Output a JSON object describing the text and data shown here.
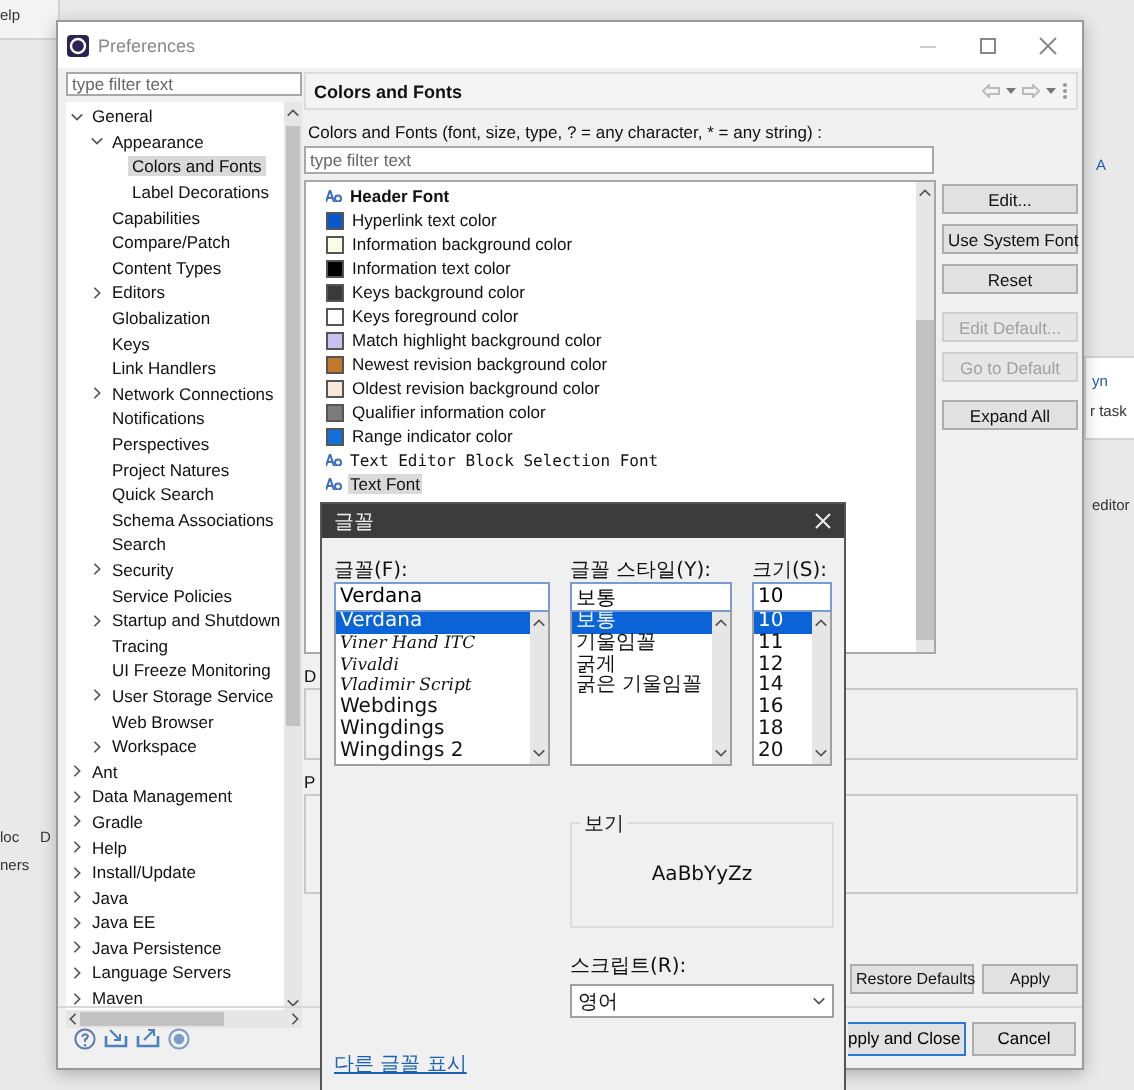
{
  "backdrop": {
    "menu_fragment": "elp",
    "tab_fragments": [
      "loc",
      "D"
    ],
    "column_fragment": "ners",
    "right_fragments": [
      {
        "kind": "link",
        "text": "A"
      },
      {
        "kind": "link",
        "text": "yn"
      },
      {
        "kind": "text",
        "text": "r task"
      },
      {
        "kind": "text",
        "text": "editor"
      }
    ]
  },
  "window": {
    "title": "Preferences"
  },
  "sidebar": {
    "filter_placeholder": "type filter text",
    "tree": [
      {
        "label": "General",
        "expanded": true,
        "selected": false,
        "children": [
          {
            "label": "Appearance",
            "expanded": true,
            "selected": false,
            "children": [
              {
                "label": "Colors and Fonts",
                "selected": true
              },
              {
                "label": "Label Decorations",
                "selected": false
              }
            ]
          },
          {
            "label": "Capabilities",
            "selected": false
          },
          {
            "label": "Compare/Patch",
            "selected": false
          },
          {
            "label": "Content Types",
            "selected": false
          },
          {
            "label": "Editors",
            "expanded": false,
            "selected": false
          },
          {
            "label": "Globalization",
            "selected": false
          },
          {
            "label": "Keys",
            "selected": false
          },
          {
            "label": "Link Handlers",
            "selected": false
          },
          {
            "label": "Network Connections",
            "expanded": false,
            "selected": false
          },
          {
            "label": "Notifications",
            "selected": false
          },
          {
            "label": "Perspectives",
            "selected": false
          },
          {
            "label": "Project Natures",
            "selected": false
          },
          {
            "label": "Quick Search",
            "selected": false
          },
          {
            "label": "Schema Associations",
            "selected": false
          },
          {
            "label": "Search",
            "selected": false
          },
          {
            "label": "Security",
            "expanded": false,
            "selected": false
          },
          {
            "label": "Service Policies",
            "selected": false
          },
          {
            "label": "Startup and Shutdown",
            "expanded": false,
            "selected": false
          },
          {
            "label": "Tracing",
            "selected": false
          },
          {
            "label": "UI Freeze Monitoring",
            "selected": false
          },
          {
            "label": "User Storage Service",
            "expanded": false,
            "selected": false
          },
          {
            "label": "Web Browser",
            "selected": false
          },
          {
            "label": "Workspace",
            "expanded": false,
            "selected": false
          }
        ]
      },
      {
        "label": "Ant",
        "expanded": false,
        "selected": false
      },
      {
        "label": "Data Management",
        "expanded": false,
        "selected": false
      },
      {
        "label": "Gradle",
        "expanded": false,
        "selected": false
      },
      {
        "label": "Help",
        "expanded": false,
        "selected": false
      },
      {
        "label": "Install/Update",
        "expanded": false,
        "selected": false
      },
      {
        "label": "Java",
        "expanded": false,
        "selected": false
      },
      {
        "label": "Java EE",
        "expanded": false,
        "selected": false
      },
      {
        "label": "Java Persistence",
        "expanded": false,
        "selected": false
      },
      {
        "label": "Language Servers",
        "expanded": false,
        "selected": false
      },
      {
        "label": "Maven",
        "expanded": false,
        "selected": false
      }
    ]
  },
  "page": {
    "title": "Colors and Fonts",
    "description": "Colors and Fonts (font, size, type, ? = any character, * = any string) :",
    "filter_placeholder": "type filter text",
    "items": [
      {
        "kind": "heading_font",
        "label": "Header Font",
        "selected": false
      },
      {
        "kind": "color",
        "label": "Hyperlink text color",
        "color": "#0a58c9",
        "selected": false
      },
      {
        "kind": "color",
        "label": "Information background color",
        "color": "#fbfbe6",
        "selected": false
      },
      {
        "kind": "color",
        "label": "Information text color",
        "color": "#000000",
        "selected": false
      },
      {
        "kind": "color",
        "label": "Keys background color",
        "color": "#3a3a3a",
        "selected": false
      },
      {
        "kind": "color",
        "label": "Keys foreground color",
        "color": "#ffffff",
        "selected": false
      },
      {
        "kind": "color",
        "label": "Match highlight background color",
        "color": "#c6c3ee",
        "selected": false
      },
      {
        "kind": "color",
        "label": "Newest revision background color",
        "color": "#c0782a",
        "selected": false
      },
      {
        "kind": "color",
        "label": "Oldest revision background color",
        "color": "#f7e8dc",
        "selected": false
      },
      {
        "kind": "color",
        "label": "Qualifier information color",
        "color": "#7c7c7c",
        "selected": false
      },
      {
        "kind": "color",
        "label": "Range indicator color",
        "color": "#1470d8",
        "selected": false
      },
      {
        "kind": "mono_font",
        "label": "Text Editor Block Selection Font",
        "selected": false
      },
      {
        "kind": "font",
        "label": "Text Font",
        "selected": true
      }
    ],
    "buttons": [
      {
        "label": "Edit...",
        "disabled": false
      },
      {
        "label": "Use System Font",
        "disabled": false
      },
      {
        "label": "Reset",
        "disabled": false
      },
      {
        "label": "Edit Default...",
        "disabled": true
      },
      {
        "label": "Go to Default",
        "disabled": true
      },
      {
        "label": "Expand All",
        "disabled": false
      }
    ],
    "description_label": "D",
    "preview_label": "P",
    "restore_button": "Restore Defaults",
    "apply_button": "Apply"
  },
  "footer": {
    "buttons": [
      "pply and Close",
      "Cancel"
    ]
  },
  "font_dialog": {
    "title": "글꼴",
    "font": {
      "label": "글꼴(F):",
      "value": "Verdana",
      "options": [
        {
          "kind": "plain",
          "label": "Verdana",
          "selected": true
        },
        {
          "kind": "script",
          "label": "Viner Hand ITC",
          "selected": false
        },
        {
          "kind": "script",
          "label": "Vivaldi",
          "selected": false
        },
        {
          "kind": "script",
          "label": "Vladimir Script",
          "selected": false
        },
        {
          "kind": "plain",
          "label": "Webdings",
          "selected": false
        },
        {
          "kind": "plain",
          "label": "Wingdings",
          "selected": false
        },
        {
          "kind": "plain",
          "label": "Wingdings 2",
          "selected": false
        }
      ]
    },
    "style": {
      "label": "글꼴 스타일(Y):",
      "value": "보통",
      "options": [
        {
          "label": "보통",
          "selected": true
        },
        {
          "label": "기울임꼴",
          "selected": false
        },
        {
          "label": "굵게",
          "selected": false
        },
        {
          "label": "굵은 기울임꼴",
          "selected": false
        }
      ]
    },
    "size": {
      "label": "크기(S):",
      "value": "10",
      "options": [
        {
          "label": "10",
          "selected": true
        },
        {
          "label": "11",
          "selected": false
        },
        {
          "label": "12",
          "selected": false
        },
        {
          "label": "14",
          "selected": false
        },
        {
          "label": "16",
          "selected": false
        },
        {
          "label": "18",
          "selected": false
        },
        {
          "label": "20",
          "selected": false
        }
      ]
    },
    "preview": {
      "label": "보기",
      "sample": "AaBbYyZz"
    },
    "script": {
      "label": "스크립트(R):",
      "value": "영어"
    },
    "more_fonts_link": "다른 글꼴 표시"
  }
}
